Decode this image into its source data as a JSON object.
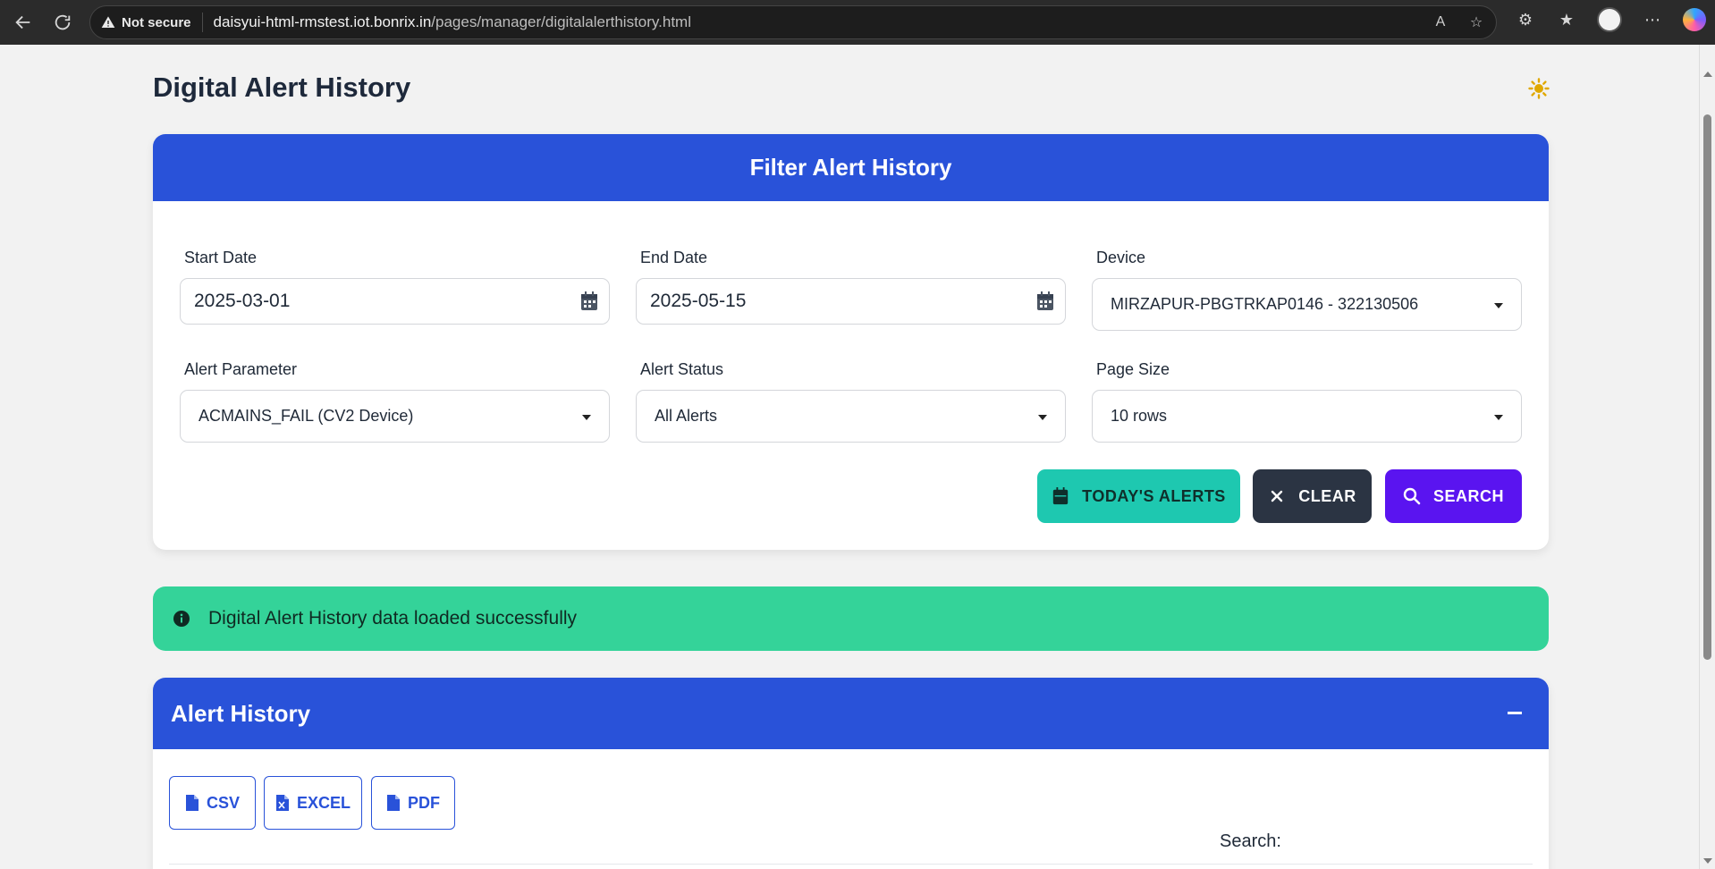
{
  "browser": {
    "security_label": "Not secure",
    "url_host": "daisyui-html-rmstest.iot.bonrix.in",
    "url_path": "/pages/manager/digitalalerthistory.html"
  },
  "page": {
    "title": "Digital Alert History"
  },
  "filter": {
    "header": "Filter Alert History",
    "start_date_label": "Start Date",
    "start_date_value": "2025-03-01",
    "end_date_label": "End Date",
    "end_date_value": "2025-05-15",
    "device_label": "Device",
    "device_value": "MIRZAPUR-PBGTRKAP0146 - 322130506",
    "alert_param_label": "Alert Parameter",
    "alert_param_value": "ACMAINS_FAIL (CV2 Device)",
    "alert_status_label": "Alert Status",
    "alert_status_value": "All Alerts",
    "page_size_label": "Page Size",
    "page_size_value": "10 rows",
    "today_button": "TODAY'S ALERTS",
    "clear_button": "CLEAR",
    "search_button": "SEARCH"
  },
  "alert": {
    "message": "Digital Alert History data loaded successfully"
  },
  "history": {
    "header": "Alert History",
    "csv_button": "CSV",
    "excel_button": "EXCEL",
    "pdf_button": "PDF",
    "search_label": "Search:"
  },
  "colors": {
    "primary": "#2952d9",
    "accent_teal": "#1ec8b0",
    "neutral": "#2b3443",
    "secondary": "#5a14f0",
    "success": "#34d399"
  }
}
